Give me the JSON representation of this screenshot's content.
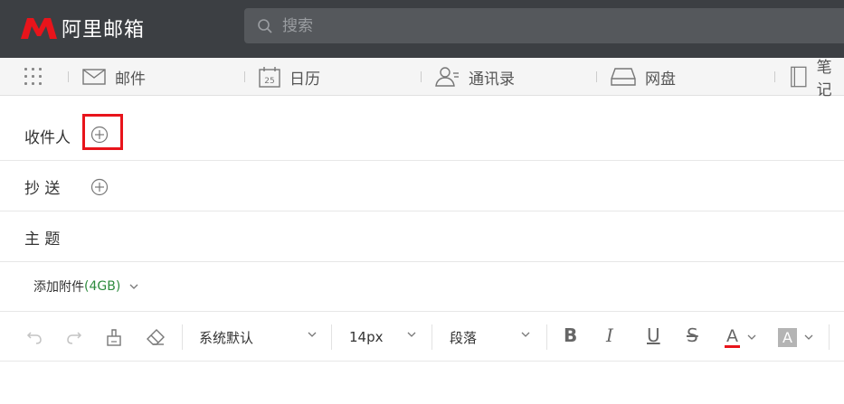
{
  "header": {
    "logo_text": "阿里邮箱",
    "brand_color": "#e8141b",
    "search_placeholder": "搜索"
  },
  "nav": {
    "items": [
      {
        "label": "邮件",
        "icon": "mail-icon"
      },
      {
        "label": "日历",
        "icon": "calendar-icon",
        "icon_text": "25"
      },
      {
        "label": "通讯录",
        "icon": "contacts-icon"
      },
      {
        "label": "网盘",
        "icon": "drive-icon"
      },
      {
        "label": "笔记",
        "icon": "notes-icon"
      }
    ]
  },
  "compose": {
    "to_label": "收件人",
    "cc_label": "抄 送",
    "subject_label": "主 题",
    "attach_label": "添加附件",
    "attach_size": "(4GB)"
  },
  "toolbar": {
    "font_family": "系统默认",
    "font_size": "14px",
    "paragraph": "段落",
    "bold": "B",
    "italic": "I",
    "underline": "U",
    "strike": "S",
    "font_color": "A",
    "bg_color": "A",
    "font_color_hex": "#e8141b",
    "bg_color_hex": "#b4b4b4"
  },
  "colors": {
    "highlight": "#e8141b",
    "attach_size_color": "#2e8b3e"
  }
}
